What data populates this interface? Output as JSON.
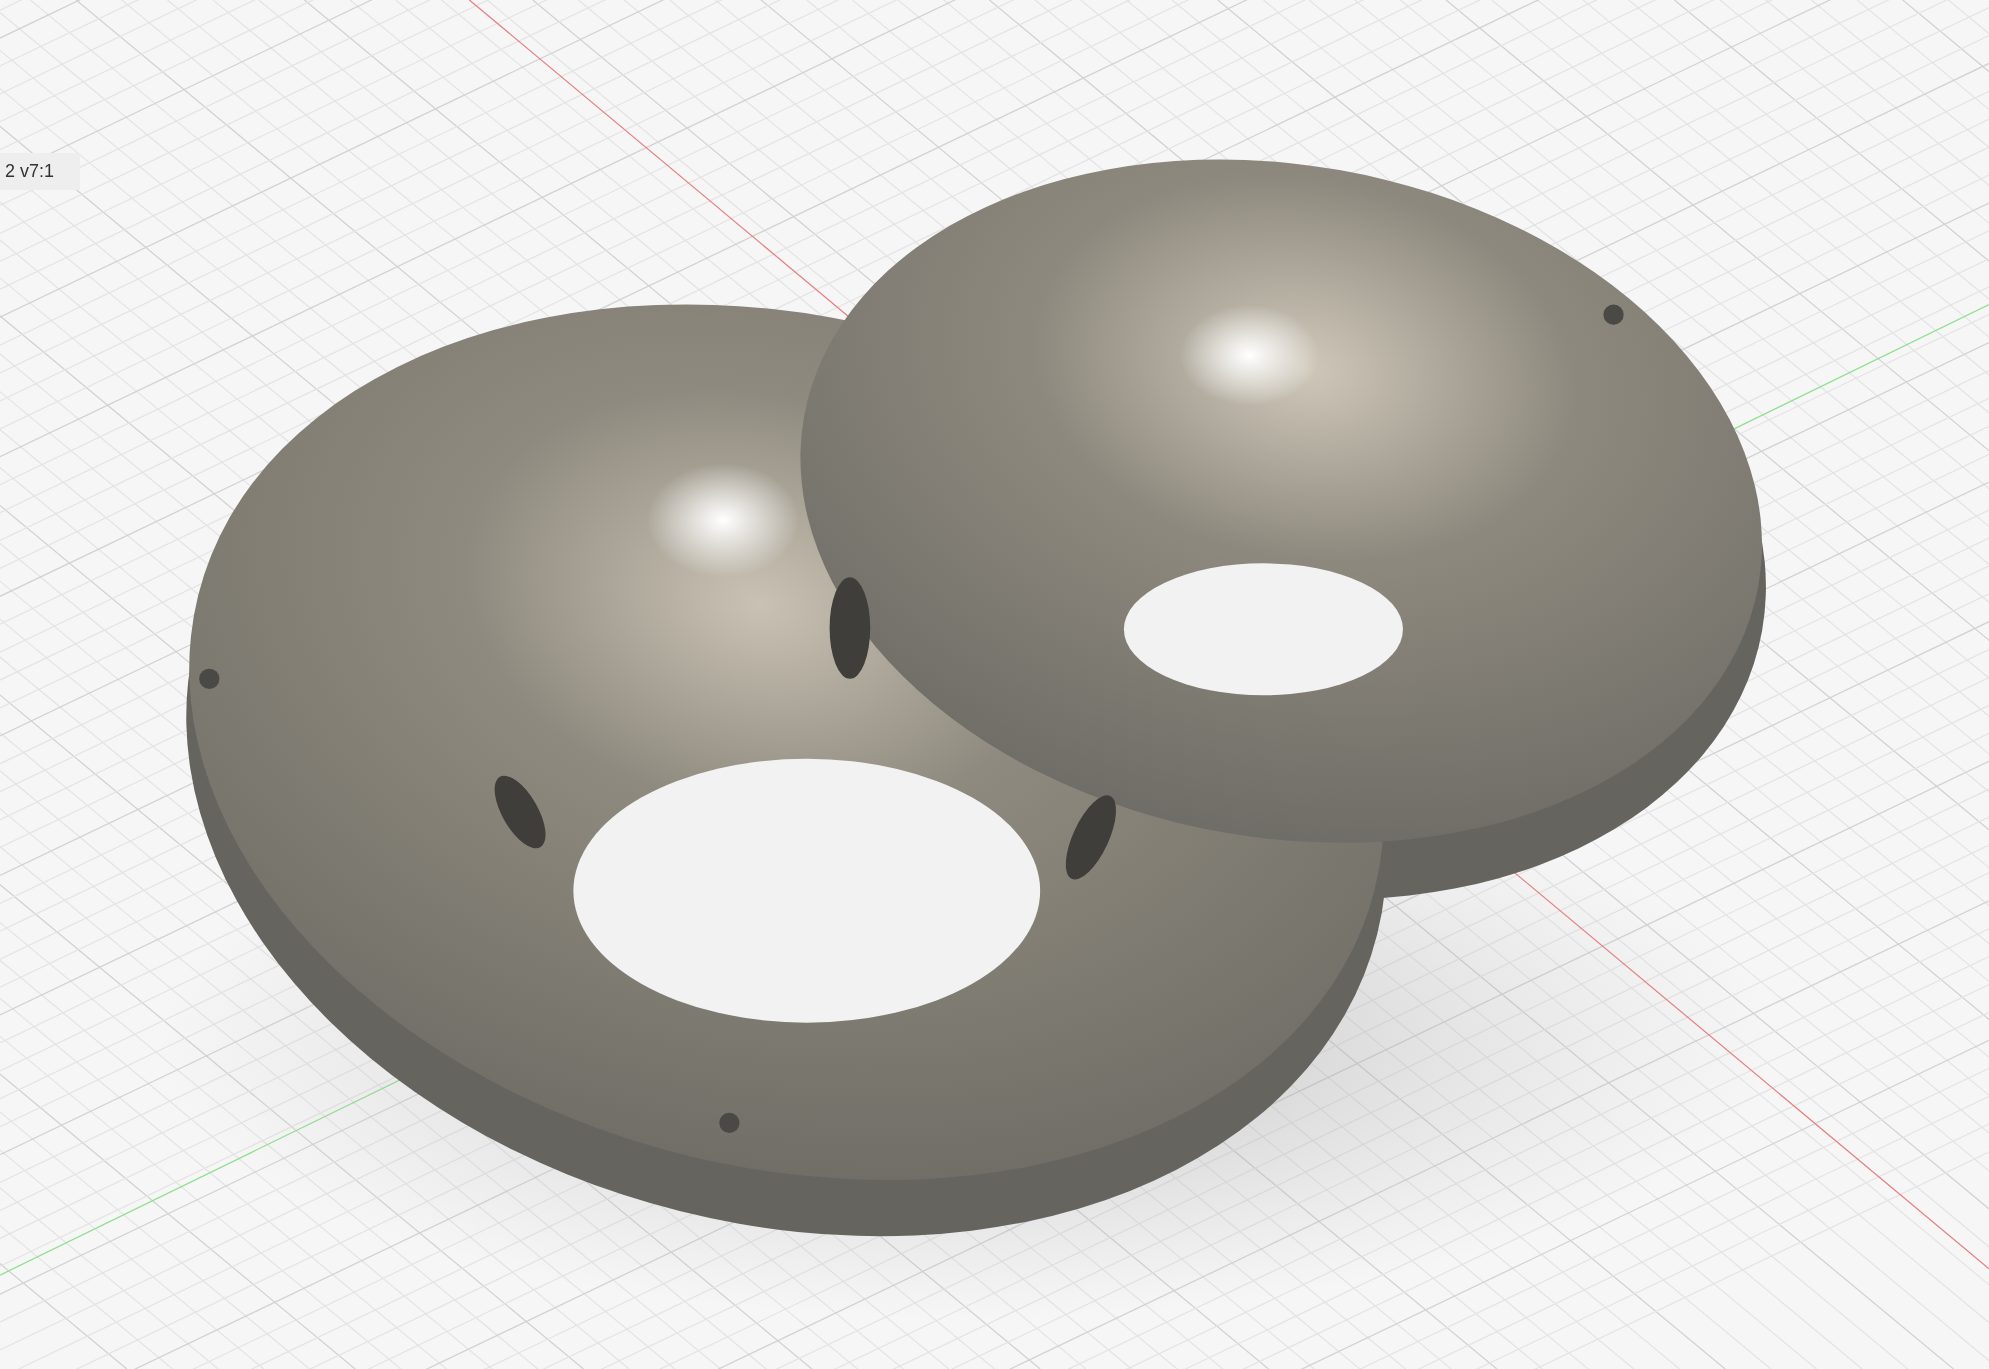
{
  "viewport": {
    "component_label": "2 v7:1"
  }
}
